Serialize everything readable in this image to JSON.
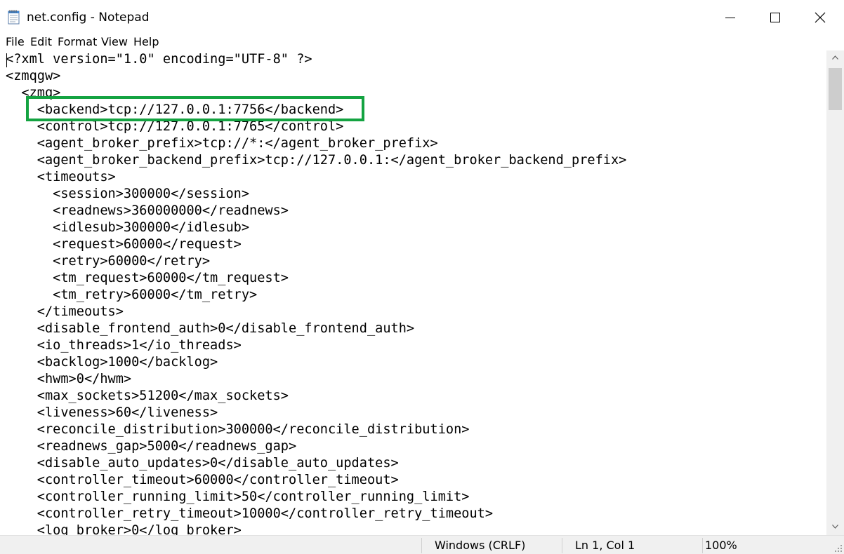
{
  "window": {
    "title": "net.config - Notepad",
    "icons": {
      "app": "notepad-icon",
      "minimize": "minimize-icon",
      "maximize": "maximize-icon",
      "close": "close-icon"
    }
  },
  "menu": {
    "file": "File",
    "edit": "Edit",
    "format": "Format",
    "view": "View",
    "help": "Help"
  },
  "editor": {
    "lines": [
      "<?xml version=\"1.0\" encoding=\"UTF-8\" ?>",
      "<zmqgw>",
      "  <zmq>",
      "    <backend>tcp://127.0.0.1:7756</backend>",
      "    <control>tcp://127.0.0.1:7765</control>",
      "    <agent_broker_prefix>tcp://*:</agent_broker_prefix>",
      "    <agent_broker_backend_prefix>tcp://127.0.0.1:</agent_broker_backend_prefix>",
      "    <timeouts>",
      "      <session>300000</session>",
      "      <readnews>360000000</readnews>",
      "      <idlesub>300000</idlesub>",
      "      <request>60000</request>",
      "      <retry>60000</retry>",
      "      <tm_request>60000</tm_request>",
      "      <tm_retry>60000</tm_retry>",
      "    </timeouts>",
      "    <disable_frontend_auth>0</disable_frontend_auth>",
      "    <io_threads>1</io_threads>",
      "    <backlog>1000</backlog>",
      "    <hwm>0</hwm>",
      "    <max_sockets>51200</max_sockets>",
      "    <liveness>60</liveness>",
      "    <reconcile_distribution>300000</reconcile_distribution>",
      "    <readnews_gap>5000</readnews_gap>",
      "    <disable_auto_updates>0</disable_auto_updates>",
      "    <controller_timeout>60000</controller_timeout>",
      "    <controller_running_limit>50</controller_running_limit>",
      "    <controller_retry_timeout>10000</controller_retry_timeout>",
      "    <log_broker>0</log_broker>"
    ],
    "highlight_color": "#14a341"
  },
  "status": {
    "line_ending": "Windows (CRLF)",
    "position": "Ln 1, Col 1",
    "zoom": "100%"
  }
}
